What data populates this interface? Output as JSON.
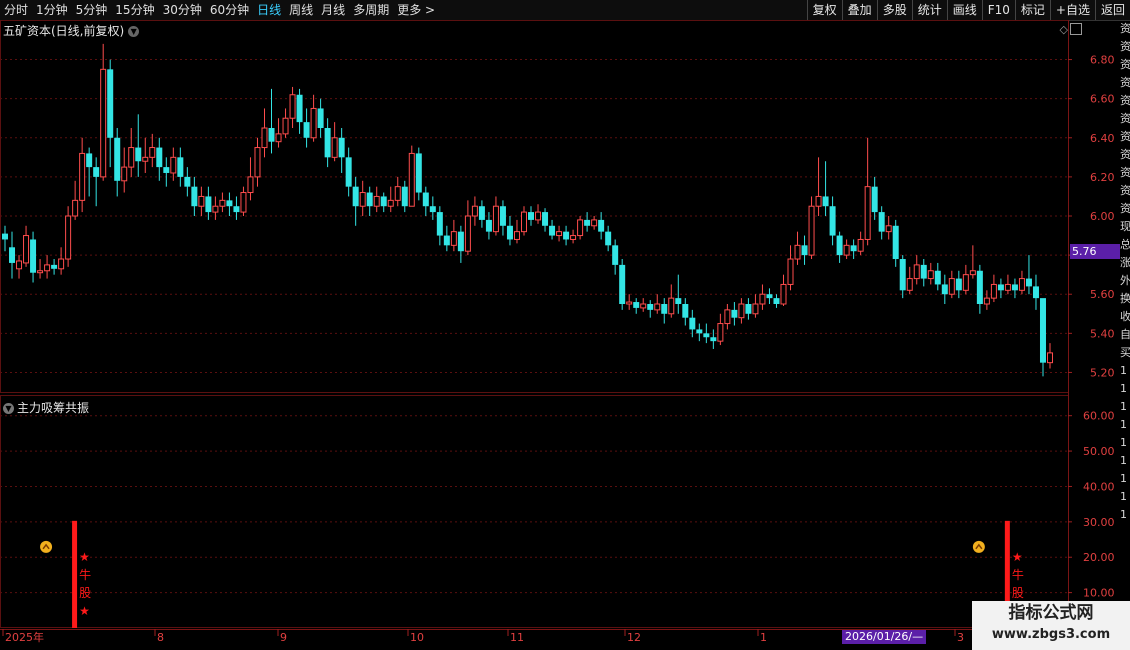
{
  "toolbar": {
    "periods": [
      "分时",
      "1分钟",
      "5分钟",
      "15分钟",
      "30分钟",
      "60分钟",
      "日线",
      "周线",
      "月线",
      "多周期",
      "更多 >"
    ],
    "active_period": "日线",
    "actions": [
      "复权",
      "叠加",
      "多股",
      "统计",
      "画线",
      "F10",
      "标记",
      "+自选",
      "返回"
    ]
  },
  "main_title": "五矿资本(日线,前复权)",
  "indicator_title": "主力吸筹共振",
  "price_axis": [
    "6.80",
    "6.60",
    "6.40",
    "6.20",
    "6.00",
    "5.80",
    "5.60",
    "5.40",
    "5.20"
  ],
  "indicator_axis": [
    "60.00",
    "50.00",
    "40.00",
    "30.00",
    "20.00",
    "10.00"
  ],
  "current_price": "5.76",
  "date_axis": [
    "2025年",
    "8",
    "9",
    "10",
    "11",
    "12",
    "1",
    "3"
  ],
  "crosshair_date": "2026/01/26/—",
  "signal_text": [
    "★",
    "牛",
    "股",
    "★"
  ],
  "right_strip": [
    "资",
    "资",
    "资",
    "资",
    "资",
    "资",
    "资",
    "资",
    "资",
    "资",
    "资",
    "现",
    "总",
    "涨",
    "外",
    "换",
    "收",
    "",
    "自",
    "买",
    "1",
    "1",
    "1",
    "1",
    "1",
    "1",
    "1",
    "1",
    "1"
  ],
  "watermark": {
    "title": "指标公式网",
    "url": "www.zbgs3.com"
  },
  "colors": {
    "up": "#ff4d4d",
    "down": "#33e5e5",
    "grid": "#5a0f0f",
    "signal": "#ff1a1a",
    "tag_bg": "#5b1fa8"
  },
  "chart_data": {
    "type": "candlestick",
    "title": "五矿资本(日线,前复权)",
    "ylim": [
      5.1,
      6.9
    ],
    "candles": [
      [
        5.91,
        5.88,
        5.95,
        5.82
      ],
      [
        5.84,
        5.76,
        5.92,
        5.68
      ],
      [
        5.73,
        5.77,
        5.8,
        5.68
      ],
      [
        5.76,
        5.9,
        5.95,
        5.74
      ],
      [
        5.88,
        5.71,
        5.92,
        5.66
      ],
      [
        5.71,
        5.72,
        5.78,
        5.68
      ],
      [
        5.72,
        5.75,
        5.8,
        5.68
      ],
      [
        5.75,
        5.73,
        5.78,
        5.7
      ],
      [
        5.73,
        5.78,
        5.84,
        5.7
      ],
      [
        5.78,
        6.0,
        6.05,
        5.74
      ],
      [
        6.0,
        6.08,
        6.18,
        5.98
      ],
      [
        6.08,
        6.32,
        6.4,
        6.02
      ],
      [
        6.32,
        6.25,
        6.35,
        6.1
      ],
      [
        6.25,
        6.2,
        6.3,
        6.05
      ],
      [
        6.2,
        6.75,
        6.88,
        6.18
      ],
      [
        6.75,
        6.4,
        6.8,
        6.25
      ],
      [
        6.4,
        6.18,
        6.45,
        6.1
      ],
      [
        6.18,
        6.25,
        6.35,
        6.12
      ],
      [
        6.25,
        6.35,
        6.45,
        6.2
      ],
      [
        6.35,
        6.28,
        6.52,
        6.2
      ],
      [
        6.28,
        6.3,
        6.4,
        6.22
      ],
      [
        6.3,
        6.35,
        6.42,
        6.25
      ],
      [
        6.35,
        6.25,
        6.4,
        6.18
      ],
      [
        6.25,
        6.22,
        6.3,
        6.15
      ],
      [
        6.22,
        6.3,
        6.35,
        6.18
      ],
      [
        6.3,
        6.2,
        6.35,
        6.15
      ],
      [
        6.2,
        6.15,
        6.25,
        6.1
      ],
      [
        6.15,
        6.05,
        6.2,
        6.0
      ],
      [
        6.05,
        6.1,
        6.15,
        6.0
      ],
      [
        6.1,
        6.02,
        6.15,
        5.98
      ],
      [
        6.02,
        6.05,
        6.1,
        5.98
      ],
      [
        6.05,
        6.08,
        6.12,
        6.02
      ],
      [
        6.08,
        6.05,
        6.12,
        6.0
      ],
      [
        6.05,
        6.02,
        6.1,
        5.98
      ],
      [
        6.02,
        6.12,
        6.15,
        6.0
      ],
      [
        6.12,
        6.2,
        6.3,
        6.08
      ],
      [
        6.2,
        6.35,
        6.4,
        6.15
      ],
      [
        6.35,
        6.45,
        6.55,
        6.3
      ],
      [
        6.45,
        6.38,
        6.65,
        6.32
      ],
      [
        6.38,
        6.42,
        6.5,
        6.35
      ],
      [
        6.42,
        6.5,
        6.55,
        6.4
      ],
      [
        6.5,
        6.62,
        6.66,
        6.45
      ],
      [
        6.62,
        6.48,
        6.65,
        6.42
      ],
      [
        6.48,
        6.4,
        6.55,
        6.35
      ],
      [
        6.4,
        6.55,
        6.62,
        6.38
      ],
      [
        6.55,
        6.45,
        6.6,
        6.4
      ],
      [
        6.45,
        6.3,
        6.5,
        6.25
      ],
      [
        6.3,
        6.4,
        6.48,
        6.28
      ],
      [
        6.4,
        6.3,
        6.45,
        6.22
      ],
      [
        6.3,
        6.15,
        6.35,
        6.1
      ],
      [
        6.15,
        6.05,
        6.2,
        5.95
      ],
      [
        6.05,
        6.12,
        6.18,
        6.0
      ],
      [
        6.12,
        6.05,
        6.15,
        6.0
      ],
      [
        6.05,
        6.1,
        6.15,
        6.02
      ],
      [
        6.1,
        6.05,
        6.12,
        6.02
      ],
      [
        6.05,
        6.08,
        6.15,
        6.02
      ],
      [
        6.08,
        6.15,
        6.2,
        6.05
      ],
      [
        6.15,
        6.05,
        6.18,
        6.02
      ],
      [
        6.05,
        6.32,
        6.36,
        6.05
      ],
      [
        6.32,
        6.12,
        6.35,
        6.08
      ],
      [
        6.12,
        6.05,
        6.15,
        6.0
      ],
      [
        6.05,
        6.02,
        6.1,
        5.98
      ],
      [
        6.02,
        5.9,
        6.05,
        5.85
      ],
      [
        5.9,
        5.85,
        5.95,
        5.82
      ],
      [
        5.85,
        5.92,
        5.98,
        5.82
      ],
      [
        5.92,
        5.82,
        5.95,
        5.76
      ],
      [
        5.82,
        6.0,
        6.08,
        5.8
      ],
      [
        6.0,
        6.05,
        6.1,
        5.95
      ],
      [
        6.05,
        5.98,
        6.08,
        5.94
      ],
      [
        5.98,
        5.92,
        6.02,
        5.88
      ],
      [
        5.92,
        6.05,
        6.1,
        5.9
      ],
      [
        6.05,
        5.95,
        6.08,
        5.9
      ],
      [
        5.95,
        5.88,
        6.0,
        5.85
      ],
      [
        5.88,
        5.92,
        5.98,
        5.86
      ],
      [
        5.92,
        6.02,
        6.05,
        5.9
      ],
      [
        6.02,
        5.98,
        6.05,
        5.95
      ],
      [
        5.98,
        6.02,
        6.06,
        5.96
      ],
      [
        6.02,
        5.95,
        6.04,
        5.92
      ],
      [
        5.95,
        5.9,
        5.98,
        5.88
      ],
      [
        5.9,
        5.92,
        5.95,
        5.87
      ],
      [
        5.92,
        5.88,
        5.95,
        5.85
      ],
      [
        5.88,
        5.9,
        5.93,
        5.86
      ],
      [
        5.9,
        5.98,
        6.0,
        5.88
      ],
      [
        5.98,
        5.95,
        6.02,
        5.92
      ],
      [
        5.95,
        5.98,
        6.0,
        5.93
      ],
      [
        5.98,
        5.92,
        6.02,
        5.88
      ],
      [
        5.92,
        5.85,
        5.95,
        5.82
      ],
      [
        5.85,
        5.75,
        5.88,
        5.7
      ],
      [
        5.75,
        5.55,
        5.78,
        5.52
      ],
      [
        5.55,
        5.56,
        5.6,
        5.52
      ],
      [
        5.56,
        5.53,
        5.58,
        5.5
      ],
      [
        5.53,
        5.55,
        5.58,
        5.51
      ],
      [
        5.55,
        5.52,
        5.57,
        5.48
      ],
      [
        5.52,
        5.55,
        5.6,
        5.5
      ],
      [
        5.55,
        5.5,
        5.58,
        5.45
      ],
      [
        5.5,
        5.58,
        5.65,
        5.48
      ],
      [
        5.58,
        5.55,
        5.7,
        5.5
      ],
      [
        5.55,
        5.48,
        5.58,
        5.44
      ],
      [
        5.48,
        5.42,
        5.52,
        5.38
      ],
      [
        5.42,
        5.4,
        5.45,
        5.36
      ],
      [
        5.4,
        5.38,
        5.45,
        5.35
      ],
      [
        5.38,
        5.36,
        5.42,
        5.32
      ],
      [
        5.36,
        5.45,
        5.5,
        5.34
      ],
      [
        5.45,
        5.52,
        5.55,
        5.42
      ],
      [
        5.52,
        5.48,
        5.56,
        5.44
      ],
      [
        5.48,
        5.55,
        5.58,
        5.45
      ],
      [
        5.55,
        5.5,
        5.58,
        5.47
      ],
      [
        5.5,
        5.55,
        5.6,
        5.48
      ],
      [
        5.55,
        5.6,
        5.65,
        5.52
      ],
      [
        5.6,
        5.58,
        5.63,
        5.55
      ],
      [
        5.58,
        5.55,
        5.6,
        5.53
      ],
      [
        5.55,
        5.65,
        5.7,
        5.54
      ],
      [
        5.65,
        5.78,
        5.85,
        5.62
      ],
      [
        5.78,
        5.85,
        5.92,
        5.75
      ],
      [
        5.85,
        5.8,
        5.9,
        5.75
      ],
      [
        5.8,
        6.05,
        6.1,
        5.78
      ],
      [
        6.05,
        6.1,
        6.3,
        6.0
      ],
      [
        6.1,
        6.05,
        6.28,
        6.0
      ],
      [
        6.05,
        5.9,
        6.1,
        5.85
      ],
      [
        5.9,
        5.8,
        5.92,
        5.76
      ],
      [
        5.8,
        5.85,
        5.88,
        5.78
      ],
      [
        5.85,
        5.82,
        5.88,
        5.78
      ],
      [
        5.82,
        5.88,
        5.92,
        5.8
      ],
      [
        5.88,
        6.15,
        6.4,
        5.85
      ],
      [
        6.15,
        6.02,
        6.2,
        5.98
      ],
      [
        6.02,
        5.92,
        6.05,
        5.88
      ],
      [
        5.92,
        5.95,
        6.0,
        5.88
      ],
      [
        5.95,
        5.78,
        5.98,
        5.74
      ],
      [
        5.78,
        5.62,
        5.8,
        5.58
      ],
      [
        5.62,
        5.68,
        5.74,
        5.6
      ],
      [
        5.68,
        5.75,
        5.8,
        5.65
      ],
      [
        5.75,
        5.68,
        5.78,
        5.64
      ],
      [
        5.68,
        5.72,
        5.76,
        5.65
      ],
      [
        5.72,
        5.65,
        5.76,
        5.62
      ],
      [
        5.65,
        5.6,
        5.7,
        5.55
      ],
      [
        5.6,
        5.68,
        5.72,
        5.58
      ],
      [
        5.68,
        5.62,
        5.72,
        5.58
      ],
      [
        5.62,
        5.7,
        5.75,
        5.6
      ],
      [
        5.7,
        5.72,
        5.85,
        5.68
      ],
      [
        5.72,
        5.55,
        5.75,
        5.5
      ],
      [
        5.55,
        5.58,
        5.62,
        5.52
      ],
      [
        5.58,
        5.65,
        5.7,
        5.56
      ],
      [
        5.65,
        5.62,
        5.68,
        5.58
      ],
      [
        5.62,
        5.65,
        5.7,
        5.6
      ],
      [
        5.65,
        5.62,
        5.68,
        5.58
      ],
      [
        5.62,
        5.68,
        5.72,
        5.6
      ],
      [
        5.68,
        5.64,
        5.8,
        5.6
      ],
      [
        5.64,
        5.58,
        5.7,
        5.52
      ],
      [
        5.58,
        5.25,
        5.4,
        5.18
      ],
      [
        5.25,
        5.3,
        5.35,
        5.22
      ]
    ],
    "indicator": {
      "name": "主力吸筹共振",
      "ylim": [
        0,
        65
      ],
      "signals": [
        {
          "index": 5,
          "value": 30,
          "label": "★牛股★"
        },
        {
          "index": 138,
          "value": 30,
          "label": "★牛股★"
        }
      ]
    }
  }
}
